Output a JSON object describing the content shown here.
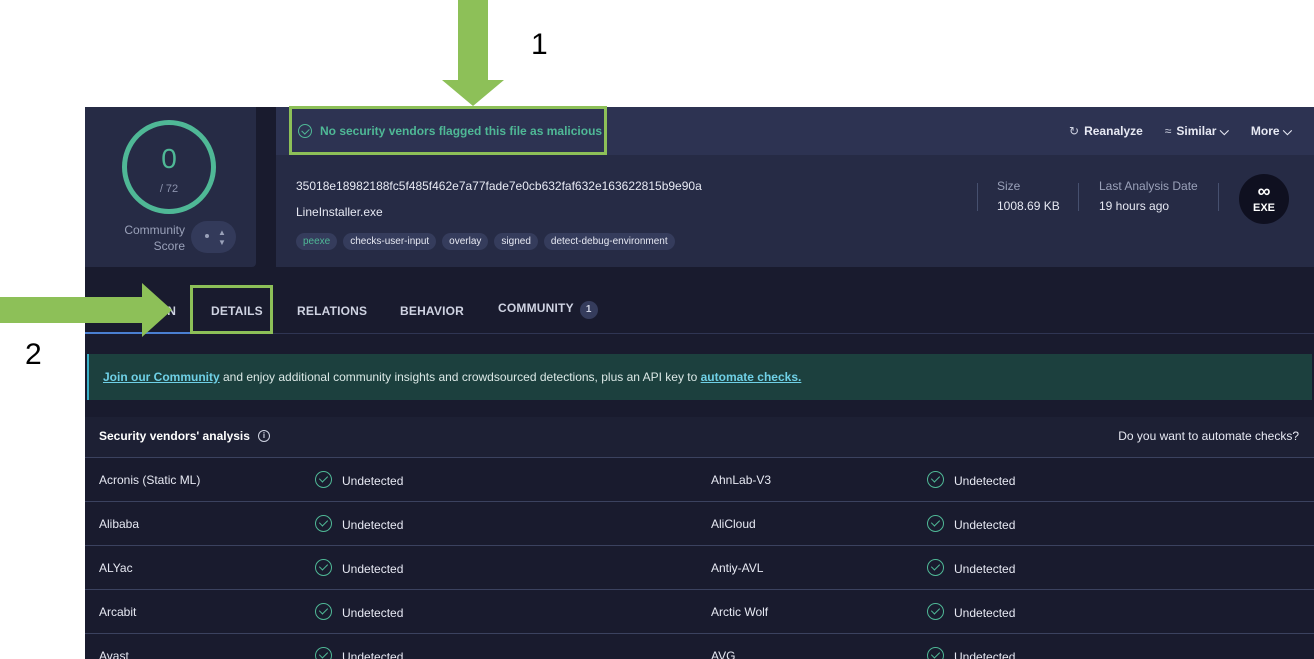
{
  "score": {
    "value": "0",
    "total": "/ 72",
    "community_label": "Community Score"
  },
  "banner": {
    "message": "No security vendors flagged this file as malicious"
  },
  "actions": {
    "reanalyze": "Reanalyze",
    "similar": "Similar",
    "more": "More"
  },
  "file": {
    "hash": "35018e18982188fc5f485f462e7a77fade7e0cb632faf632e163622815b9e90a",
    "name": "LineInstaller.exe",
    "tags": [
      "peexe",
      "checks-user-input",
      "overlay",
      "signed",
      "detect-debug-environment"
    ],
    "size_label": "Size",
    "size_value": "1008.69 KB",
    "last_label": "Last Analysis Date",
    "last_value": "19 hours ago",
    "type_badge": "EXE"
  },
  "tabs": [
    {
      "label": "DETECTION"
    },
    {
      "label": "DETAILS"
    },
    {
      "label": "RELATIONS"
    },
    {
      "label": "BEHAVIOR"
    },
    {
      "label": "COMMUNITY",
      "badge": "1"
    }
  ],
  "notice": {
    "link1": "Join our Community",
    "text": " and enjoy additional community insights and crowdsourced detections, plus an API key to ",
    "link2": "automate checks."
  },
  "vendors": {
    "title": "Security vendors' analysis",
    "right_text": "Do you want to automate checks?",
    "rows": [
      [
        {
          "name": "Acronis (Static ML)",
          "result": "Undetected"
        },
        {
          "name": "AhnLab-V3",
          "result": "Undetected"
        }
      ],
      [
        {
          "name": "Alibaba",
          "result": "Undetected"
        },
        {
          "name": "AliCloud",
          "result": "Undetected"
        }
      ],
      [
        {
          "name": "ALYac",
          "result": "Undetected"
        },
        {
          "name": "Antiy-AVL",
          "result": "Undetected"
        }
      ],
      [
        {
          "name": "Arcabit",
          "result": "Undetected"
        },
        {
          "name": "Arctic Wolf",
          "result": "Undetected"
        }
      ],
      [
        {
          "name": "Avast",
          "result": "Undetected"
        },
        {
          "name": "AVG",
          "result": "Undetected"
        }
      ]
    ]
  },
  "annotations": {
    "label1": "1",
    "label2": "2",
    "color": "#8dc058"
  }
}
